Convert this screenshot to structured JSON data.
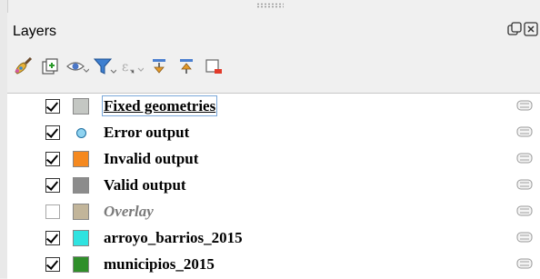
{
  "panel": {
    "title": "Layers",
    "title_buttons": [
      {
        "name": "float-panel-icon"
      },
      {
        "name": "close-panel-icon"
      }
    ]
  },
  "toolbar": {
    "tools": [
      {
        "name": "style-manager-icon"
      },
      {
        "name": "add-group-icon"
      },
      {
        "name": "visibility-eye-icon"
      },
      {
        "name": "filter-legend-icon"
      },
      {
        "name": "filter-expression-icon"
      },
      {
        "name": "expand-all-icon"
      },
      {
        "name": "collapse-all-icon"
      },
      {
        "name": "remove-layer-icon"
      }
    ]
  },
  "layers": [
    {
      "label": "Fixed geometries",
      "checked": true,
      "symbol": "fill",
      "color": "#c4c7c3",
      "selected": true,
      "italic": false
    },
    {
      "label": "Error output",
      "checked": true,
      "symbol": "point",
      "color": "#8fd3f0",
      "selected": false,
      "italic": false
    },
    {
      "label": "Invalid output",
      "checked": true,
      "symbol": "fill",
      "color": "#f5891f",
      "selected": false,
      "italic": false
    },
    {
      "label": "Valid output",
      "checked": true,
      "symbol": "fill",
      "color": "#8c8c8c",
      "selected": false,
      "italic": false
    },
    {
      "label": "Overlay",
      "checked": false,
      "symbol": "fill",
      "color": "#c2b59a",
      "selected": false,
      "italic": true
    },
    {
      "label": "arroyo_barrios_2015",
      "checked": true,
      "symbol": "fill",
      "color": "#2fe3e0",
      "selected": false,
      "italic": false
    },
    {
      "label": "municipios_2015",
      "checked": true,
      "symbol": "fill",
      "color": "#2f8f2a",
      "selected": false,
      "italic": false
    }
  ]
}
